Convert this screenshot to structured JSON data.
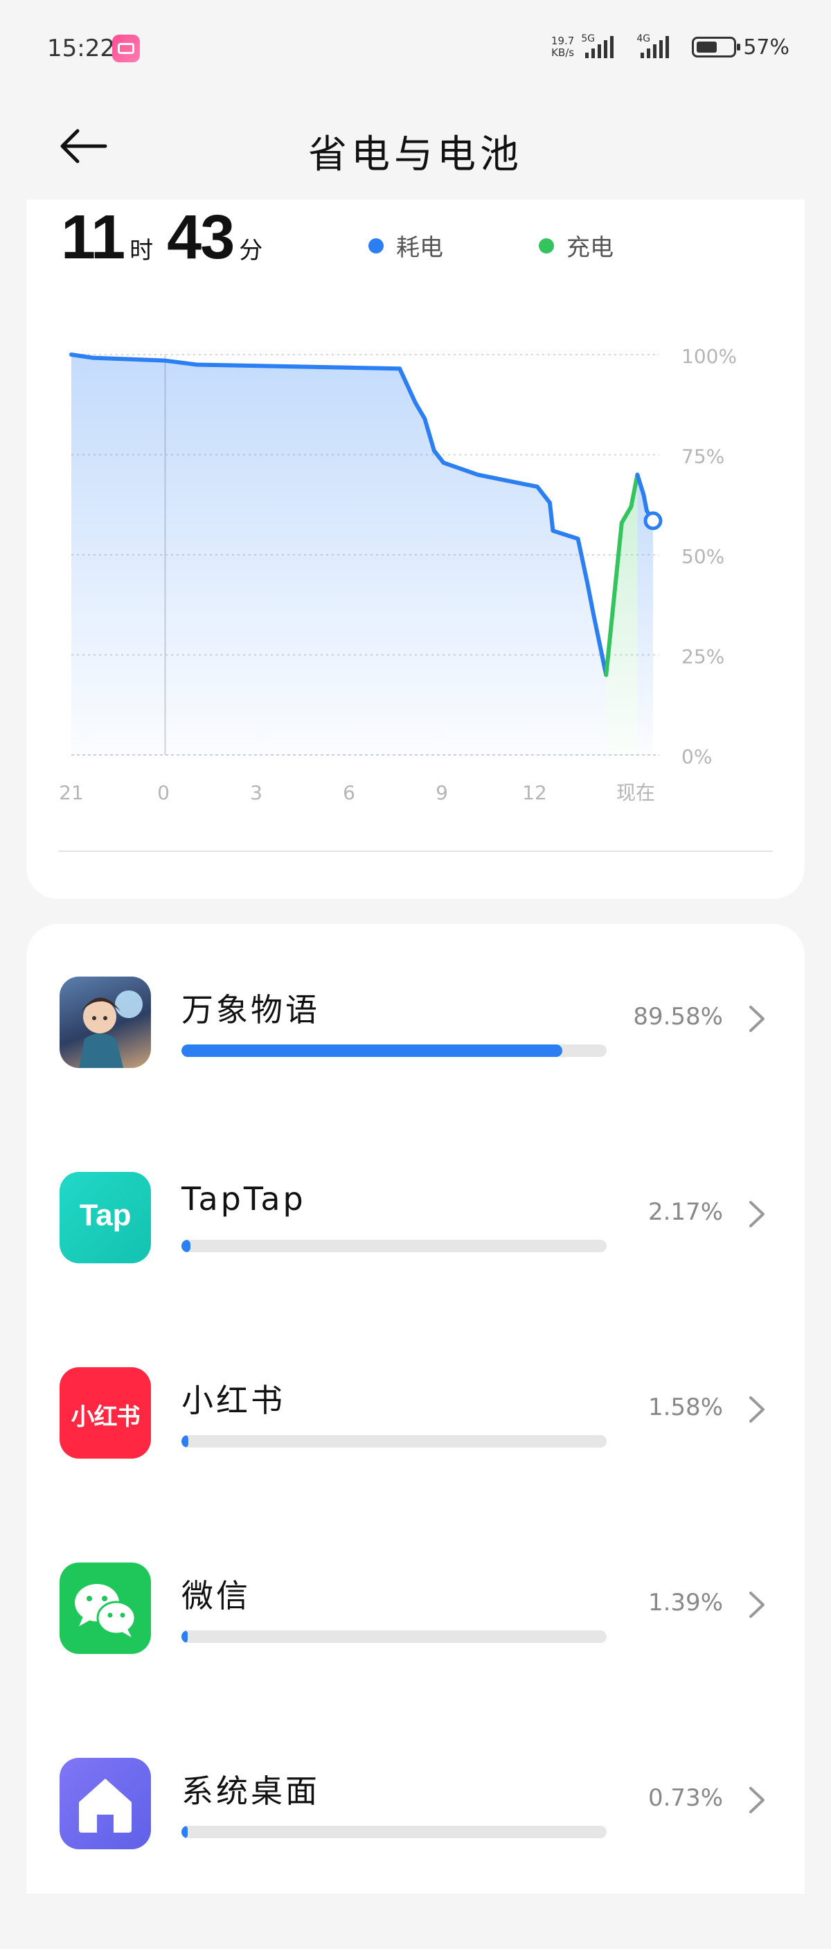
{
  "status_bar": {
    "time": "15:22",
    "net_speed_value": "19.7",
    "net_speed_unit": "KB/s",
    "signal1_label": "5G",
    "signal2_label": "4G",
    "battery_percent": "57%",
    "battery_level": 0.57
  },
  "header": {
    "title": "省电与电池",
    "back_icon": "arrow-left-icon"
  },
  "summary": {
    "hours": "11",
    "hours_unit": "时",
    "minutes": "43",
    "minutes_unit": "分",
    "legend_discharge": "耗电",
    "legend_charge": "充电"
  },
  "colors": {
    "discharge": "#2b7ff2",
    "charge": "#33c45e",
    "text_muted": "#888888"
  },
  "chart_data": {
    "type": "line",
    "x_tick_labels": [
      "21",
      "0",
      "3",
      "6",
      "9",
      "12",
      "现在"
    ],
    "y_tick_labels": [
      "100%",
      "75%",
      "50%",
      "25%",
      "0%"
    ],
    "ylim": [
      0,
      100
    ],
    "x_unit": "hours since 21:00",
    "series": [
      {
        "name": "耗电",
        "points": [
          [
            0,
            100
          ],
          [
            0.7,
            99.2
          ],
          [
            3,
            98.5
          ],
          [
            4,
            97.5
          ],
          [
            10.5,
            96.5
          ],
          [
            11,
            88
          ],
          [
            11.3,
            84
          ],
          [
            11.6,
            76
          ],
          [
            11.9,
            73
          ],
          [
            13,
            70
          ],
          [
            14.9,
            67
          ],
          [
            15.3,
            63
          ],
          [
            15.4,
            56
          ],
          [
            16.2,
            54
          ],
          [
            16.5,
            43
          ],
          [
            16.7,
            35
          ],
          [
            17.1,
            20
          ]
        ]
      },
      {
        "name": "充电",
        "points": [
          [
            17.1,
            20
          ],
          [
            17.6,
            58
          ],
          [
            17.9,
            62
          ],
          [
            18.1,
            70
          ]
        ]
      },
      {
        "name": "耗电",
        "points": [
          [
            18.1,
            70
          ],
          [
            18.3,
            65
          ],
          [
            18.4,
            61
          ],
          [
            18.6,
            58.5
          ]
        ]
      }
    ],
    "current_value": 58.5,
    "grid": true,
    "legend": "top"
  },
  "apps": [
    {
      "name": "万象物语",
      "percent": "89.58%",
      "value": 89.58,
      "icon": "wanxiang-game-icon"
    },
    {
      "name": "TapTap",
      "percent": "2.17%",
      "value": 2.17,
      "icon": "taptap-icon",
      "icon_text": "Tap"
    },
    {
      "name": "小红书",
      "percent": "1.58%",
      "value": 1.58,
      "icon": "xiaohongshu-icon",
      "icon_text": "小红书"
    },
    {
      "name": "微信",
      "percent": "1.39%",
      "value": 1.39,
      "icon": "wechat-icon"
    },
    {
      "name": "系统桌面",
      "percent": "0.73%",
      "value": 0.73,
      "icon": "home-icon"
    }
  ]
}
